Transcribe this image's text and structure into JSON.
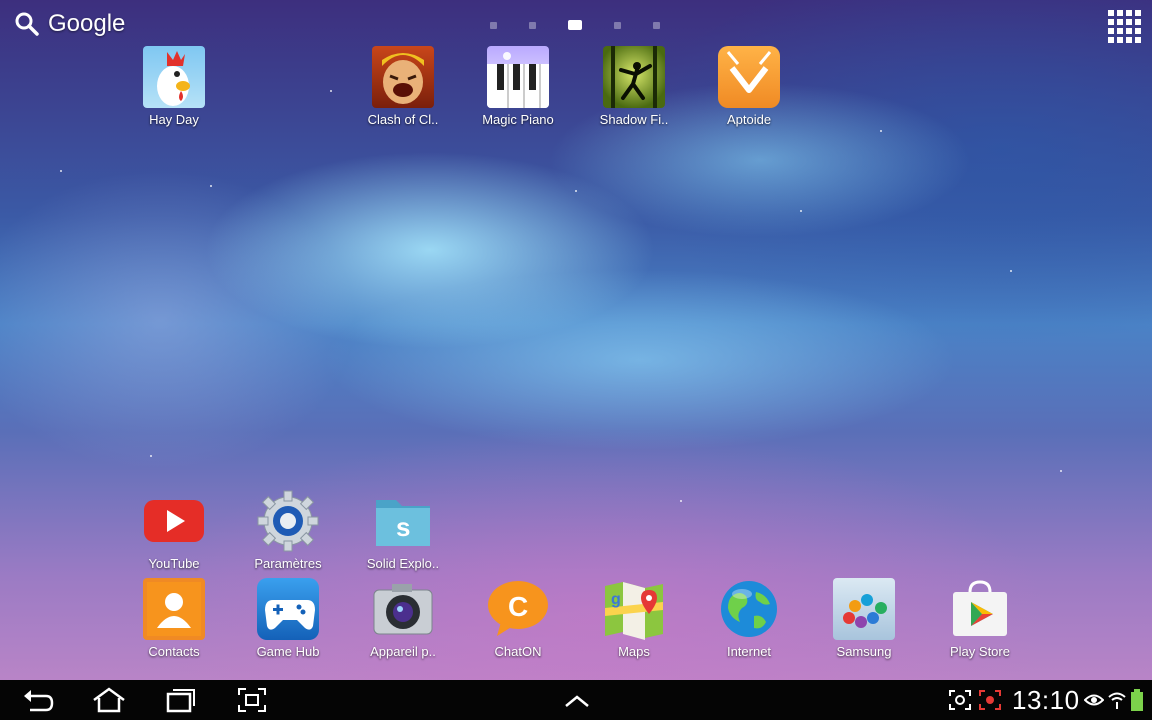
{
  "search": {
    "label": "Google",
    "icon": "search-icon"
  },
  "pages": {
    "count": 5,
    "active_index": 2
  },
  "apps_button": {
    "icon": "apps-grid-icon"
  },
  "top_apps": [
    {
      "label": "Hay Day",
      "icon": "hay-day-icon"
    },
    {
      "label": "Clash of Cl..",
      "icon": "clash-of-clans-icon"
    },
    {
      "label": "Magic Piano",
      "icon": "magic-piano-icon"
    },
    {
      "label": "Shadow Fi..",
      "icon": "shadow-fight-icon"
    },
    {
      "label": "Aptoide",
      "icon": "aptoide-icon"
    }
  ],
  "mid_apps": [
    {
      "label": "YouTube",
      "icon": "youtube-icon"
    },
    {
      "label": "Paramètres",
      "icon": "settings-gear-icon"
    },
    {
      "label": "Solid Explo..",
      "icon": "solid-explorer-icon"
    }
  ],
  "dock_apps": [
    {
      "label": "Contacts",
      "icon": "contacts-icon"
    },
    {
      "label": "Game Hub",
      "icon": "game-hub-icon"
    },
    {
      "label": "Appareil p..",
      "icon": "camera-icon"
    },
    {
      "label": "ChatON",
      "icon": "chaton-icon"
    },
    {
      "label": "Maps",
      "icon": "maps-icon"
    },
    {
      "label": "Internet",
      "icon": "internet-globe-icon"
    },
    {
      "label": "Samsung",
      "icon": "samsung-apps-icon"
    },
    {
      "label": "Play Store",
      "icon": "play-store-icon"
    }
  ],
  "navbar": {
    "buttons": [
      "back-icon",
      "home-icon",
      "recent-apps-icon",
      "screenshot-icon",
      "up-arrow-icon"
    ],
    "status_icons": [
      "screen-capture-icon",
      "recording-icon",
      "eye-icon",
      "wifi-icon",
      "battery-icon"
    ],
    "time": "13:10"
  },
  "colors": {
    "navbar_bg": "#050505",
    "youtube_red": "#e52d27",
    "chaton_orange": "#f7941d",
    "battery_green": "#7cd24b"
  }
}
